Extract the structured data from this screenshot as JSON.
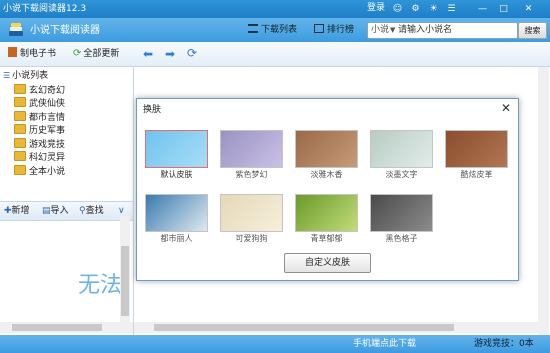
{
  "titlebar": {
    "title": "小说下载阅读器12.3",
    "login": "登录",
    "icons": [
      "user-icon",
      "settings-icon",
      "skin-icon",
      "menu-icon",
      "minimize-icon",
      "maximize-icon",
      "close-icon"
    ]
  },
  "header": {
    "app_title": "小说下载阅读器",
    "download_list": "下载列表",
    "ranking": "排行榜",
    "search": {
      "scope": "小说",
      "placeholder": "请输入小说名",
      "button": "搜索"
    }
  },
  "toolbar": {
    "make_ebook": "制电子书",
    "update_all": "全部更新"
  },
  "sidebar": {
    "root": "小说列表",
    "items": [
      {
        "label": "玄幻奇幻"
      },
      {
        "label": "武侠仙侠"
      },
      {
        "label": "都市言情"
      },
      {
        "label": "历史军事"
      },
      {
        "label": "游戏竞技"
      },
      {
        "label": "科幻灵异"
      },
      {
        "label": "全本小说"
      }
    ],
    "tools": {
      "add": "新增",
      "import": "导入",
      "find": "查找"
    },
    "preview_text": "无法"
  },
  "dialog": {
    "title": "换肤",
    "skins": [
      {
        "label": "默认皮肤",
        "colors": [
          "#6fc3ee",
          "#a8def6"
        ],
        "selected": true
      },
      {
        "label": "紫色梦幻",
        "colors": [
          "#9a92c4",
          "#c9c1e4"
        ],
        "selected": false
      },
      {
        "label": "淡雅木香",
        "colors": [
          "#9a6a48",
          "#c79a78"
        ],
        "selected": false
      },
      {
        "label": "淡墨文字",
        "colors": [
          "#b6ccc2",
          "#e3ecea"
        ],
        "selected": false
      },
      {
        "label": "酷炫皮革",
        "colors": [
          "#8a4d2e",
          "#b27652"
        ],
        "selected": false
      },
      {
        "label": "都市丽人",
        "colors": [
          "#3a7bb0",
          "#dfe8f0"
        ],
        "selected": false
      },
      {
        "label": "可爱狗狗",
        "colors": [
          "#e5d8b8",
          "#f6efdc"
        ],
        "selected": false
      },
      {
        "label": "青草郁郁",
        "colors": [
          "#6a9a2a",
          "#c2dc7a"
        ],
        "selected": false
      },
      {
        "label": "黑色格子",
        "colors": [
          "#4a4a4a",
          "#8c8c8c"
        ],
        "selected": false
      }
    ],
    "custom_button": "自定义皮肤"
  },
  "status": {
    "mobile_download": "手机端点此下载",
    "game": "游戏竞技：0本"
  }
}
